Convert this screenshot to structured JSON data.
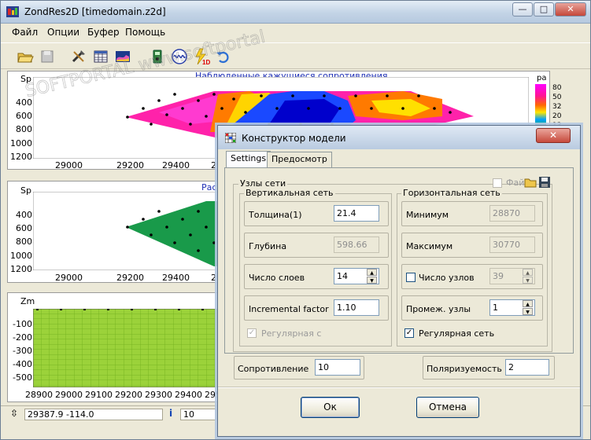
{
  "window": {
    "title": "ZondRes2D [timedomain.z2d]",
    "btn_minimize": "—",
    "btn_maximize": "□",
    "btn_close": "✕"
  },
  "menu": [
    "Файл",
    "Опции",
    "Буфер",
    "Помощь"
  ],
  "toolbar_icons": [
    "open-icon",
    "save-icon",
    "tools-icon",
    "table-icon",
    "chart-icon",
    "device-icon",
    "wave-icon",
    "lightning-1d-icon",
    "undo-icon"
  ],
  "plot1": {
    "title": "Наблюденные кажущиеся сопротивления",
    "y_axis_title": "Sp",
    "y_ticks": [
      "400",
      "600",
      "800",
      "1000",
      "1200"
    ],
    "x_ticks": [
      "29000",
      "29200",
      "29400",
      "29"
    ],
    "colorbar_label": "ра",
    "colorbar_ticks": [
      "80",
      "50",
      "32",
      "20",
      "13"
    ],
    "colors": [
      "#ff00ff",
      "#ff1493",
      "#ff6a00",
      "#ffb000",
      "#ffe600",
      "#00a0ff",
      "#0000ff",
      "#00c000"
    ]
  },
  "plot2": {
    "title": "Расч",
    "y_axis_title": "Sp",
    "y_ticks": [
      "400",
      "600",
      "800",
      "1000",
      "1200"
    ],
    "x_ticks": [
      "29000",
      "29200",
      "29400",
      "29"
    ]
  },
  "plot3": {
    "y_axis_title": "Zm",
    "y_ticks": [
      "-100",
      "-200",
      "-300",
      "-400",
      "-500"
    ],
    "x_ticks": [
      "28900",
      "29000",
      "29100",
      "29200",
      "29300",
      "29400",
      "29500",
      "29"
    ]
  },
  "status": {
    "coords": "29387.9 -114.0",
    "value": "10",
    "info_icon": "i"
  },
  "watermark": "SOFTPORTAL www.softportal.com",
  "dialog": {
    "title": "Конструктор модели",
    "close": "✕",
    "tabs": [
      "Settings",
      "Предосмотр"
    ],
    "nodes_group": "Узлы сети",
    "file_label": "Фай",
    "vertical": {
      "label": "Вертикальная  сеть",
      "fields": [
        {
          "label": "Толщина(1)",
          "value": "21.4",
          "disabled": false,
          "spinner": false
        },
        {
          "label": "Глубина",
          "value": "598.66",
          "disabled": true,
          "spinner": false
        },
        {
          "label": "Число слоев",
          "value": "14",
          "disabled": false,
          "spinner": true
        },
        {
          "label": "Incremental factor",
          "value": "1.10",
          "disabled": false,
          "spinner": false
        }
      ],
      "regular_label": "Регулярная с",
      "regular_checked": "✓"
    },
    "horizontal": {
      "label": "Горизонтальная  сеть",
      "fields": [
        {
          "label": "Минимум",
          "value": "28870",
          "disabled": true,
          "spinner": false
        },
        {
          "label": "Максимум",
          "value": "30770",
          "disabled": true,
          "spinner": false
        },
        {
          "label": "Число узлов",
          "value": "39",
          "disabled": true,
          "spinner": true
        },
        {
          "label": "Промеж. узлы",
          "value": "1",
          "disabled": false,
          "spinner": true
        }
      ],
      "regular_label": "Регулярная сеть",
      "regular_checked": "✓"
    },
    "resistance_label": "Сопротивление",
    "resistance_value": "10",
    "polarization_label": "Поляризуемость",
    "polarization_value": "2",
    "ok": "Ок",
    "cancel": "Отмена"
  }
}
